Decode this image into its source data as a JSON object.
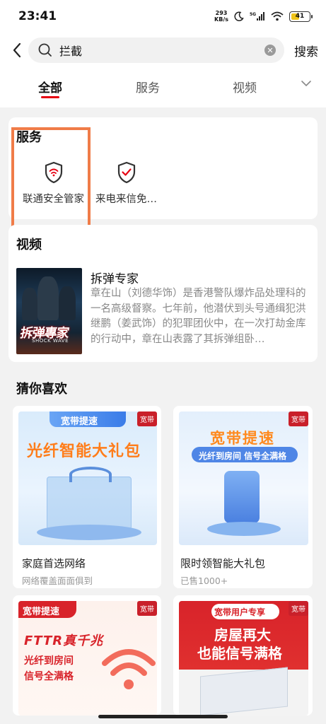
{
  "status_bar": {
    "time": "23:41",
    "net_speed_value": "293",
    "net_speed_unit": "KB/s",
    "battery_level": "41"
  },
  "search": {
    "query": "拦截",
    "button_label": "搜索"
  },
  "tabs": [
    {
      "label": "全部",
      "active": true
    },
    {
      "label": "服务",
      "active": false
    },
    {
      "label": "视频",
      "active": false
    }
  ],
  "services": {
    "title": "服务",
    "items": [
      {
        "label": "联通安全管家",
        "icon": "shield-wifi-icon"
      },
      {
        "label": "来电来信免…",
        "icon": "shield-check-icon"
      }
    ]
  },
  "video": {
    "section_title": "视频",
    "title": "拆弹专家",
    "description": "章在山（刘德华饰）是香港警队爆炸品处理科的一名高级督察。七年前，他潜伏到头号通缉犯洪继鹏（姜武饰）的犯罪团伙中，在一次打劫金库的行动中，章在山表露了其拆弹组卧…",
    "poster_title": "拆弹專家",
    "poster_subtitle": "SHOCK WAVE"
  },
  "guess": {
    "title": "猜你喜欢",
    "products": [
      {
        "name": "家庭首选网络",
        "sub": "网络覆盖面面俱到",
        "tag": "宽带",
        "banner_ribbon": "宽带提速",
        "banner_headline": "光纤智能大礼包"
      },
      {
        "name": "限时领智能大礼包",
        "sub": "已售1000+",
        "tag": "宽带",
        "banner_headline": "宽带提速",
        "banner_sub": "光纤到房间 信号全满格"
      },
      {
        "tag": "宽带",
        "banner_ribbon": "宽带提速",
        "banner_headline": "FTTR真千兆",
        "banner_line1": "光纤到房间",
        "banner_line2": "信号全满格"
      },
      {
        "tag": "宽带",
        "banner_ribbon": "宽带用户专享",
        "banner_line1": "房屋再大",
        "banner_line2": "也能信号满格"
      }
    ]
  },
  "colors": {
    "accent": "#e60012",
    "highlight": "#f07c48",
    "tag": "#c9202a"
  }
}
